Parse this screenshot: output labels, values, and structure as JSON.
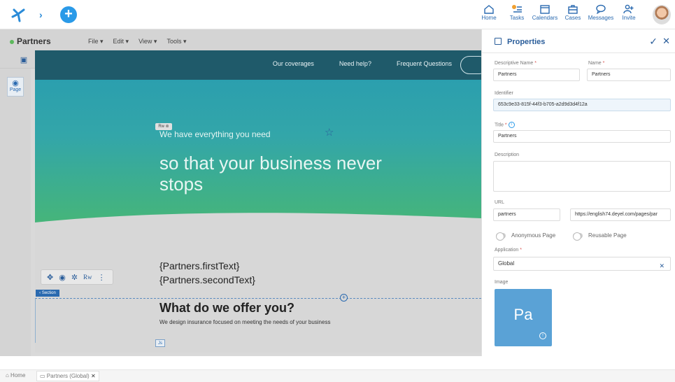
{
  "topnav": {
    "items": [
      {
        "label": "Home",
        "icon": "home-icon"
      },
      {
        "label": "Tasks",
        "icon": "tasks-icon"
      },
      {
        "label": "Calendars",
        "icon": "calendar-icon"
      },
      {
        "label": "Cases",
        "icon": "cases-icon"
      },
      {
        "label": "Messages",
        "icon": "message-icon"
      },
      {
        "label": "Invite",
        "icon": "invite-icon"
      }
    ]
  },
  "editor": {
    "page_name": "Partners",
    "menus": [
      "File ▾",
      "Edit ▾",
      "View ▾",
      "Tools ▾"
    ],
    "width_label": "1400px",
    "page_tool_label": "Page"
  },
  "canvas": {
    "nav_links": [
      "Our coverages",
      "Need help?",
      "Frequent Questions"
    ],
    "rw_badge": "Rw ⊚",
    "hero_small": "We have everything you need",
    "hero_big": "so that your business never stops",
    "first_text": "{Partners.firstText}",
    "second_text": "{Partners.secondText}",
    "section_tag": "‹ Section",
    "offer_title": "What do we offer you?",
    "offer_sub": "We design insurance focused on meeting the needs of your business",
    "js_tag": "Js",
    "float_rw": "Rw"
  },
  "properties": {
    "title": "Properties",
    "descriptive_name_label": "Descriptive Name",
    "descriptive_name": "Partners",
    "name_label": "Name",
    "name": "Partners",
    "identifier_label": "Identifier",
    "identifier": "653c9e33-815f-44f3-b705-a2d9d3d4f12a",
    "title_label": "Title",
    "title_value": "Partners",
    "description_label": "Description",
    "description": "",
    "url_label": "URL",
    "url_value": "partners",
    "url_full": "https://english74.deyel.com/pages/par",
    "anonymous_label": "Anonymous Page",
    "reusable_label": "Reusable Page",
    "application_label": "Application",
    "application": "Global",
    "image_label": "Image",
    "image_text": "Pa"
  },
  "tabs": {
    "home": "⌂ Home",
    "partners": "▭ Partners (Global)"
  },
  "colors": {
    "accent": "#2a5d9a",
    "brand_blue": "#2a9ae8",
    "nav_dark": "#1f5a6a",
    "hero_top": "#2b9fae",
    "hero_bottom": "#46b57a",
    "image_tile": "#5aa2d6"
  }
}
